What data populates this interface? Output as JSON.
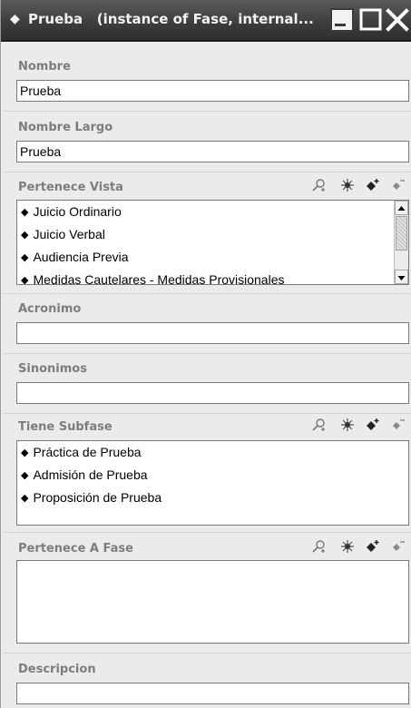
{
  "window": {
    "title": "Prueba   (instance of Fase, internal...",
    "icons": {
      "title": "diamond-icon",
      "minimize": "minimize-icon",
      "maximize": "maximize-icon",
      "close": "close-icon"
    }
  },
  "fields": {
    "nombre": {
      "label": "Nombre",
      "value": "Prueba"
    },
    "nombre_largo": {
      "label": "Nombre Largo",
      "value": "Prueba"
    },
    "pertenece_vista": {
      "label": "Pertenece Vista",
      "items": [
        "Juicio Ordinario",
        "Juicio Verbal",
        "Audiencia Previa",
        "Medidas Cautelares - Medidas Provisionales"
      ]
    },
    "acronimo": {
      "label": "Acronimo",
      "value": ""
    },
    "sinonimos": {
      "label": "Sinonimos",
      "value": ""
    },
    "tiene_subfase": {
      "label": "Tiene Subfase",
      "items": [
        "Práctica de Prueba",
        "Admisión de Prueba",
        "Proposición de Prueba"
      ]
    },
    "pertenece_a_fase": {
      "label": "Pertenece A Fase",
      "items": []
    },
    "descripcion": {
      "label": "Descripcion",
      "value": ""
    }
  },
  "toolbar_icons": [
    "search-value-icon",
    "create-instance-icon",
    "add-value-icon",
    "remove-value-icon"
  ],
  "colors": {
    "titlebar": "#3c3c3c",
    "background": "#ebebeb",
    "label": "#7d7d7d",
    "border": "#7a7a7a"
  }
}
